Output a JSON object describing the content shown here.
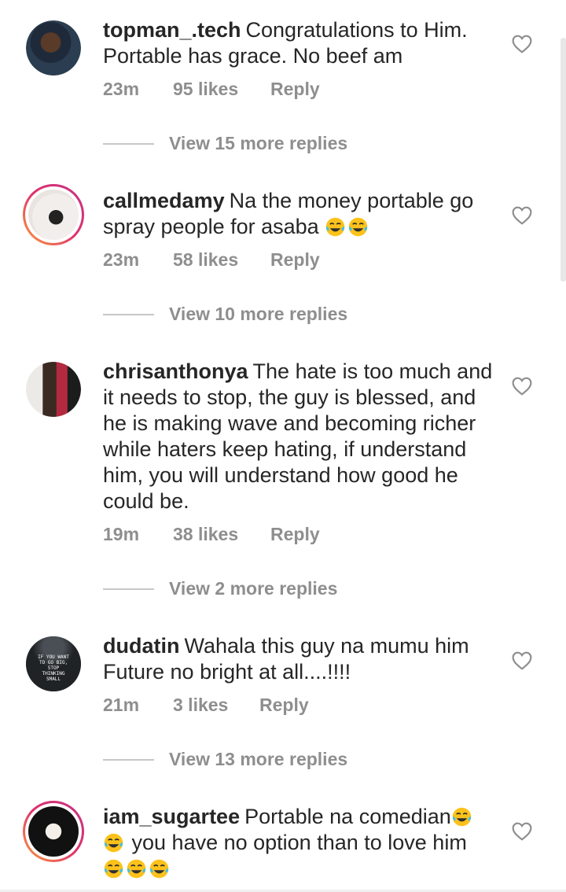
{
  "comments": [
    {
      "username": "topman_.tech",
      "line1": "Congratulations to Him.",
      "lines": [
        "Portable has grace. No beef am"
      ],
      "time": "23m",
      "likes": "95 likes",
      "reply": "Reply",
      "view_replies": "View 15 more replies"
    },
    {
      "username": "callmedamy",
      "line1": "Na the money portable go",
      "lines": [
        "spray people for asaba"
      ],
      "time": "23m",
      "likes": "58 likes",
      "reply": "Reply",
      "view_replies": "View 10 more replies"
    },
    {
      "username": "chrisanthonya",
      "line1": "The hate is too much and",
      "lines": [
        "it needs to stop, the guy is blessed, and",
        "he is making wave and becoming richer",
        "while haters keep hating, if understand",
        "him, you will understand how good he",
        "could be."
      ],
      "time": "19m",
      "likes": "38 likes",
      "reply": "Reply",
      "view_replies": "View 2 more replies"
    },
    {
      "username": "dudatin",
      "line1": "Wahala this guy na mumu him",
      "lines": [
        "Future no bright at all....!!!!"
      ],
      "time": "21m",
      "likes": "3 likes",
      "reply": "Reply",
      "view_replies": "View 13 more replies",
      "avatar_text": "IF YOU WANT TO GO BIG, STOP THINKING SMALL"
    },
    {
      "username": "iam_sugartee",
      "line1": "Portable na comedian",
      "lines": [
        "you have no option than to love him"
      ]
    }
  ],
  "icons": {
    "heart": "heart-outline-icon",
    "emoji": "face-with-tears-of-joy-icon"
  },
  "colors": {
    "text": "#262626",
    "muted": "#8e8e8e",
    "story_ring": "#e1306c"
  }
}
